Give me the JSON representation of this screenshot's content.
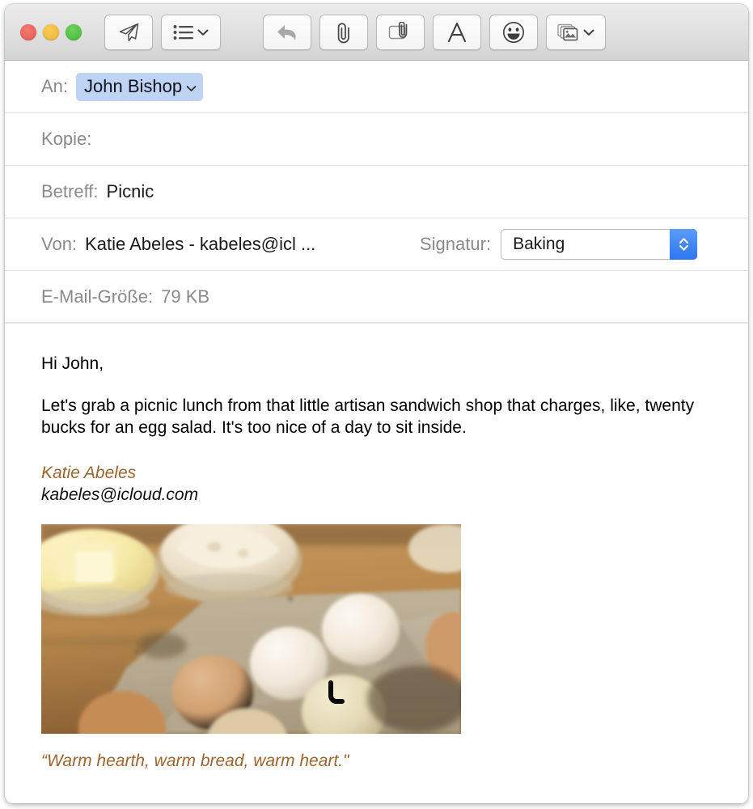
{
  "window": {
    "traffic_lights": [
      "close",
      "minimize",
      "zoom"
    ]
  },
  "toolbar": {
    "buttons": [
      {
        "name": "send-button",
        "icon": "paper-plane-icon",
        "label": ""
      },
      {
        "name": "header-fields-button",
        "icon": "list-icon",
        "label": "",
        "has_chevron": true
      },
      {
        "name": "reply-button",
        "icon": "reply-arrow-icon",
        "label": ""
      },
      {
        "name": "attach-button",
        "icon": "paperclip-icon",
        "label": ""
      },
      {
        "name": "markup-button",
        "icon": "markup-attachment-icon",
        "label": ""
      },
      {
        "name": "format-button",
        "icon": "letter-a-icon",
        "label": "A"
      },
      {
        "name": "emoji-button",
        "icon": "smiley-face-icon",
        "label": ""
      },
      {
        "name": "photo-browser-button",
        "icon": "photos-icon",
        "label": "",
        "has_chevron": true
      }
    ]
  },
  "headers": {
    "to": {
      "label": "An:",
      "recipient": "John Bishop"
    },
    "cc": {
      "label": "Kopie:",
      "value": ""
    },
    "subject": {
      "label": "Betreff:",
      "value": "Picnic"
    },
    "from": {
      "label": "Von:",
      "value": "Katie Abeles - kabeles@icl ..."
    },
    "signature": {
      "label": "Signatur:",
      "selected": "Baking"
    },
    "size": {
      "label": "E-Mail-Größe:",
      "value": "79 KB"
    }
  },
  "message": {
    "greeting": "Hi John,",
    "paragraph": "Let's grab a picnic lunch from that little artisan sandwich shop that charges, like, twenty bucks for an egg salad. It's too nice of a day to sit inside.",
    "signature_name": "Katie Abeles",
    "signature_email": "kabeles@icloud.com",
    "photo_alt": "Eggs in a cardboard carton with bowls of butter and flour on a wooden table",
    "quote": "“Warm hearth, warm bread, warm heart.\""
  },
  "colors": {
    "accent_blue": "#2f76ef",
    "token_blue": "#bfd3f5",
    "signature_brown": "#9b6430",
    "label_gray": "#8a8a8a",
    "toolbar_gray": "#e2e2e2"
  }
}
